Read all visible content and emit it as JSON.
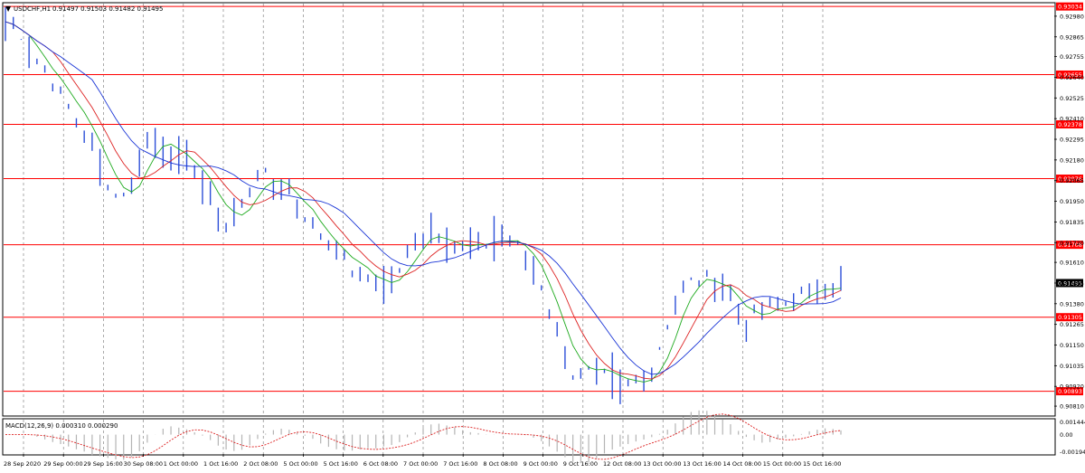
{
  "chart_data": [
    {
      "type": "candlestick",
      "symbol_label": "USDCHF,H1",
      "ohlc_label": "0.91497 0.91503 0.91482 0.91495",
      "ylim": [
        0.9076,
        0.9305
      ],
      "y_ticks": [
        "0.92980",
        "0.92865",
        "0.92755",
        "0.92640",
        "0.92525",
        "0.92410",
        "0.92295",
        "0.92180",
        "0.92065",
        "0.91950",
        "0.91835",
        "0.91720",
        "0.91610",
        "0.91495",
        "0.91380",
        "0.91265",
        "0.91150",
        "0.91035",
        "0.90920",
        "0.90810"
      ],
      "x_ticks": [
        "28 Sep 2020",
        "29 Sep 00:00",
        "29 Sep 16:00",
        "30 Sep 08:00",
        "1 Oct 00:00",
        "1 Oct 16:00",
        "2 Oct 08:00",
        "5 Oct 00:00",
        "5 Oct 16:00",
        "6 Oct 08:00",
        "7 Oct 00:00",
        "7 Oct 16:00",
        "8 Oct 08:00",
        "9 Oct 00:00",
        "9 Oct 16:00",
        "12 Oct 08:00",
        "13 Oct 00:00",
        "13 Oct 16:00",
        "14 Oct 08:00",
        "15 Oct 00:00",
        "15 Oct 16:00"
      ],
      "horizontal_levels": [
        {
          "label": "0.93034",
          "value": 0.93034
        },
        {
          "label": "0.92655",
          "value": 0.92655
        },
        {
          "label": "0.92378",
          "value": 0.92378
        },
        {
          "label": "0.92076",
          "value": 0.92076
        },
        {
          "label": "0.91708",
          "value": 0.91708
        },
        {
          "label": "0.91305",
          "value": 0.91305
        },
        {
          "label": "0.90893",
          "value": 0.90893
        }
      ],
      "current_price_label": "0.91495",
      "current_price": 0.91495,
      "price_path": [
        [
          0,
          0.9295
        ],
        [
          2,
          0.9288
        ],
        [
          4,
          0.9272
        ],
        [
          6,
          0.9262
        ],
        [
          8,
          0.9246
        ],
        [
          10,
          0.9236
        ],
        [
          12,
          0.9212
        ],
        [
          14,
          0.9198
        ],
        [
          16,
          0.9202
        ],
        [
          18,
          0.9232
        ],
        [
          20,
          0.9228
        ],
        [
          22,
          0.9218
        ],
        [
          24,
          0.9212
        ],
        [
          26,
          0.9196
        ],
        [
          28,
          0.9183
        ],
        [
          30,
          0.9191
        ],
        [
          32,
          0.9211
        ],
        [
          34,
          0.9205
        ],
        [
          36,
          0.92
        ],
        [
          38,
          0.9188
        ],
        [
          40,
          0.9175
        ],
        [
          42,
          0.9167
        ],
        [
          44,
          0.9158
        ],
        [
          46,
          0.9152
        ],
        [
          48,
          0.9148
        ],
        [
          50,
          0.9155
        ],
        [
          52,
          0.9176
        ],
        [
          54,
          0.918
        ],
        [
          56,
          0.9172
        ],
        [
          58,
          0.917
        ],
        [
          60,
          0.9168
        ],
        [
          62,
          0.9176
        ],
        [
          64,
          0.9172
        ],
        [
          66,
          0.9165
        ],
        [
          68,
          0.9148
        ],
        [
          70,
          0.912
        ],
        [
          72,
          0.91
        ],
        [
          74,
          0.91
        ],
        [
          76,
          0.9096
        ],
        [
          78,
          0.9092
        ],
        [
          80,
          0.9095
        ],
        [
          82,
          0.91
        ],
        [
          84,
          0.9128
        ],
        [
          86,
          0.9148
        ],
        [
          88,
          0.9152
        ],
        [
          90,
          0.915
        ],
        [
          92,
          0.9142
        ],
        [
          94,
          0.9128
        ],
        [
          96,
          0.9134
        ],
        [
          98,
          0.9134
        ],
        [
          100,
          0.914
        ],
        [
          102,
          0.9146
        ],
        [
          104,
          0.9148
        ],
        [
          106,
          0.91495
        ]
      ],
      "indicator": {
        "label": "MACD(12,26,9) 0.000310 0.000290",
        "y_ticks": [
          "0.001444",
          "0.00",
          "-0.001949"
        ],
        "ylim": [
          -0.0022,
          0.0017
        ]
      },
      "colors": {
        "price": "#2d4fd8",
        "ma_fast": "#1faa1f",
        "ma_mid": "#dd2222",
        "ma_slow": "#1a35d6",
        "level": "#ff0000",
        "signal": "#dd2222",
        "histogram": "#b4b4b4"
      }
    }
  ]
}
